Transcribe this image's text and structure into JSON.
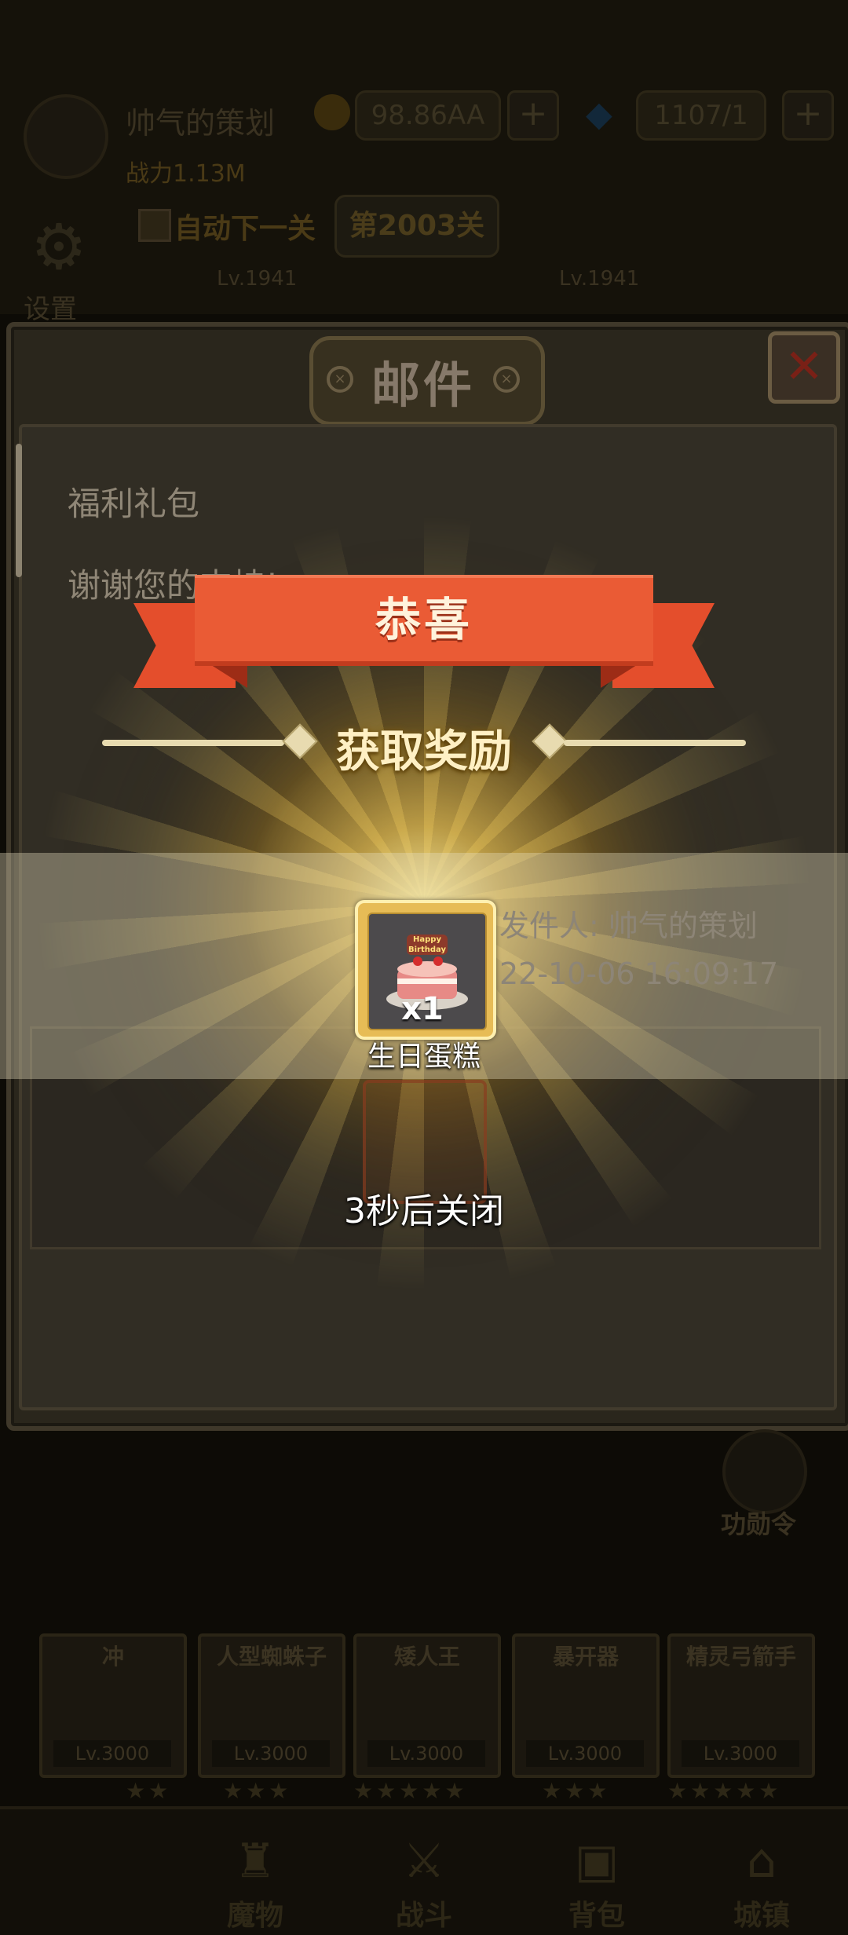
{
  "top": {
    "player_name": "帅气的策划",
    "gold": "98.86AA",
    "gems": "1107/1",
    "power": "战力1.13M",
    "auto_next_label": "自动下一关",
    "stage_label": "第2003关",
    "settings_label": "设置",
    "enemy_lv_left": "Lv.1941",
    "enemy_lv_right": "Lv.1941"
  },
  "mail": {
    "title": "邮件",
    "subject": "福利礼包",
    "body": "谢谢您的支持!",
    "sender": "发件人: 帅气的策划",
    "date": "22-10-06 16:09:17"
  },
  "reward": {
    "banner": "恭喜",
    "title": "获取奖励",
    "item_name": "生日蛋糕",
    "item_count": "x1",
    "cake_text": "Happy Birthday",
    "close_hint": "3秒后关闭"
  },
  "side": {
    "right_label": "功勋令"
  },
  "heroes": [
    {
      "name": "冲",
      "lv": "Lv.3000"
    },
    {
      "name": "人型蜘蛛子",
      "lv": "Lv.3000"
    },
    {
      "name": "矮人王",
      "lv": "Lv.3000"
    },
    {
      "name": "暴开器",
      "lv": "Lv.3000"
    },
    {
      "name": "精灵弓箭手",
      "lv": "Lv.3000"
    }
  ],
  "nav": [
    "魔物",
    "战斗",
    "背包",
    "城镇"
  ]
}
